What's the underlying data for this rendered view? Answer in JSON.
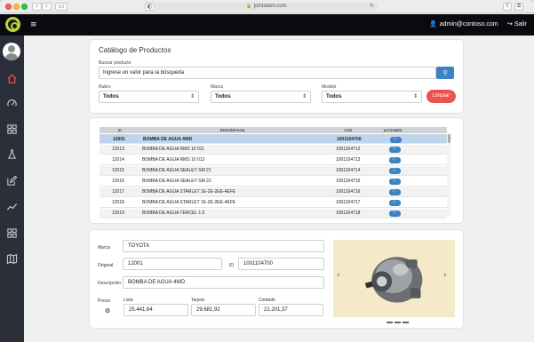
{
  "browser": {
    "url": "joinlatam.com"
  },
  "topbar": {
    "user_email": "admin@contoso.com",
    "logout_label": "Salir"
  },
  "sidebar": {
    "items": [
      {
        "icon": "home-icon"
      },
      {
        "icon": "dashboard-gauge-icon"
      },
      {
        "icon": "grid-icon"
      },
      {
        "icon": "flask-icon"
      },
      {
        "icon": "edit-icon"
      },
      {
        "icon": "chart-line-icon"
      },
      {
        "icon": "apps-grid-icon"
      },
      {
        "icon": "map-icon"
      }
    ],
    "active_color": "#e8534f"
  },
  "catalog": {
    "title": "Catálogo de Productos",
    "search_label": "Buscar producto",
    "search_placeholder": "Ingrese un valor para la búsqueda",
    "filters": [
      {
        "label": "Rubro",
        "value": "Todos"
      },
      {
        "label": "Marca",
        "value": "Todos"
      },
      {
        "label": "Modelo",
        "value": "Todos"
      }
    ],
    "clear_label": "Limpiar"
  },
  "table": {
    "columns": [
      "ID",
      "DESCRIPCION",
      "COD",
      "ACCIONES"
    ],
    "rows": [
      {
        "id": "12001",
        "desc": "BOMBA DE AGUA 4WD",
        "cod": "1001104700",
        "selected": true
      },
      {
        "id": "12013",
        "desc": "BOMBA DE AGUA RMS 10 011",
        "cod": "1001104712"
      },
      {
        "id": "12014",
        "desc": "BOMBA DE AGUA RMS 10 012",
        "cod": "1001104713"
      },
      {
        "id": "12015",
        "desc": "BOMBA DE AGUA SEALEY SM 21",
        "cod": "1001104714"
      },
      {
        "id": "12016",
        "desc": "BOMBA DE AGUA SEALEY SM 22",
        "cod": "1001104715"
      },
      {
        "id": "12017",
        "desc": "BOMBA DE AGUA STARLET 1E-2E-2EE-4EFE",
        "cod": "1001104716"
      },
      {
        "id": "12018",
        "desc": "BOMBA DE AGUA STARLET 1E-2E-2EE-4EFE",
        "cod": "1001104717"
      },
      {
        "id": "12019",
        "desc": "BOMBA DE AGUA TERCEL 1.5",
        "cod": "1001104718"
      }
    ]
  },
  "detail": {
    "marca_label": "Marca",
    "marca": "TOYOTA",
    "original_label": "Original",
    "original": "12001",
    "id_label": "ID",
    "id": "1001104700",
    "descripcion_label": "Descripción",
    "descripcion": "BOMBA DE AGUA 4WD",
    "precio_label": "Precio",
    "lista_label": "Lista",
    "lista": "25.441,64",
    "tarjeta_label": "Tarjeta",
    "tarjeta": "29.681,92",
    "contado_label": "Contado",
    "contado": "21.201,37"
  }
}
